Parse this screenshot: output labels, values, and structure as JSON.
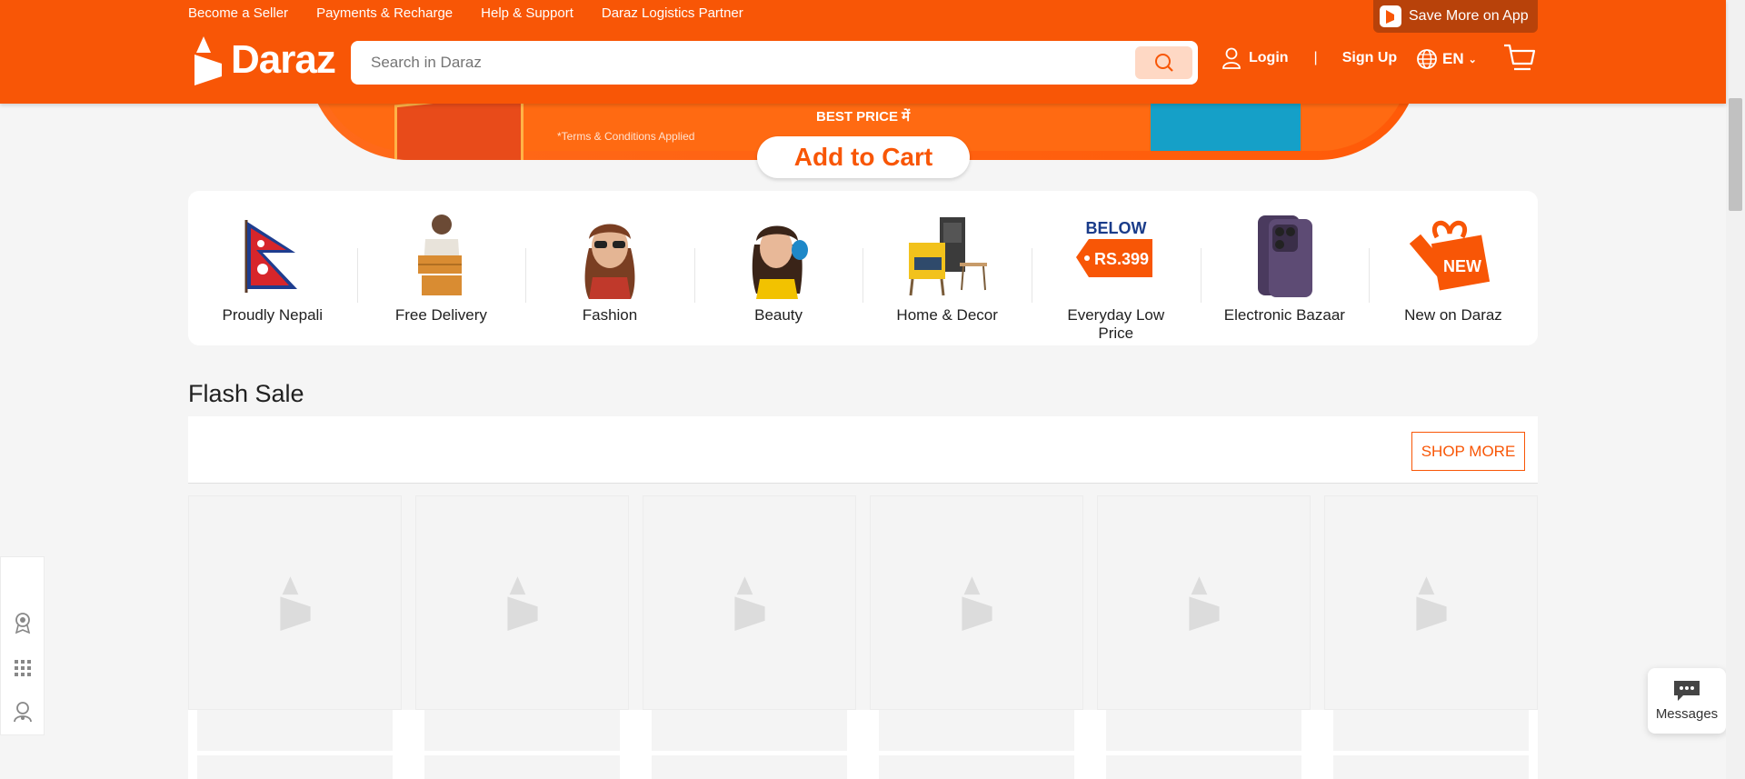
{
  "header": {
    "top_links": [
      "Become a Seller",
      "Payments & Recharge",
      "Help & Support",
      "Daraz Logistics Partner"
    ],
    "app_promo": "Save More on App",
    "logo_text": "Daraz",
    "search": {
      "placeholder": "Search in Daraz",
      "value": ""
    },
    "login_label": "Login",
    "separator": "|",
    "signup_label": "Sign Up",
    "language": "EN",
    "brand_color": "#f85606"
  },
  "banner": {
    "best_price": "BEST PRICE में",
    "terms": "*Terms & Conditions Applied",
    "cta": "Add to Cart"
  },
  "categories": [
    {
      "name": "Proudly Nepali",
      "icon": "nepal-flag-icon"
    },
    {
      "name": "Free Delivery",
      "icon": "delivery-person-icon"
    },
    {
      "name": "Fashion",
      "icon": "fashion-model-icon"
    },
    {
      "name": "Beauty",
      "icon": "beauty-model-icon"
    },
    {
      "name": "Home & Decor",
      "icon": "armchair-icon"
    },
    {
      "name": "Everyday Low Price",
      "icon": "price-tag-icon",
      "tag_top": "BELOW",
      "tag_price": "RS.399"
    },
    {
      "name": "Electronic Bazaar",
      "icon": "smartphone-icon"
    },
    {
      "name": "New on Daraz",
      "icon": "gift-new-icon",
      "tag": "NEW"
    }
  ],
  "flash_sale": {
    "title": "Flash Sale",
    "shop_more": "SHOP MORE"
  },
  "side_rail": [
    "badge-icon",
    "grid-icon",
    "user-support-icon"
  ],
  "messages": {
    "label": "Messages"
  }
}
